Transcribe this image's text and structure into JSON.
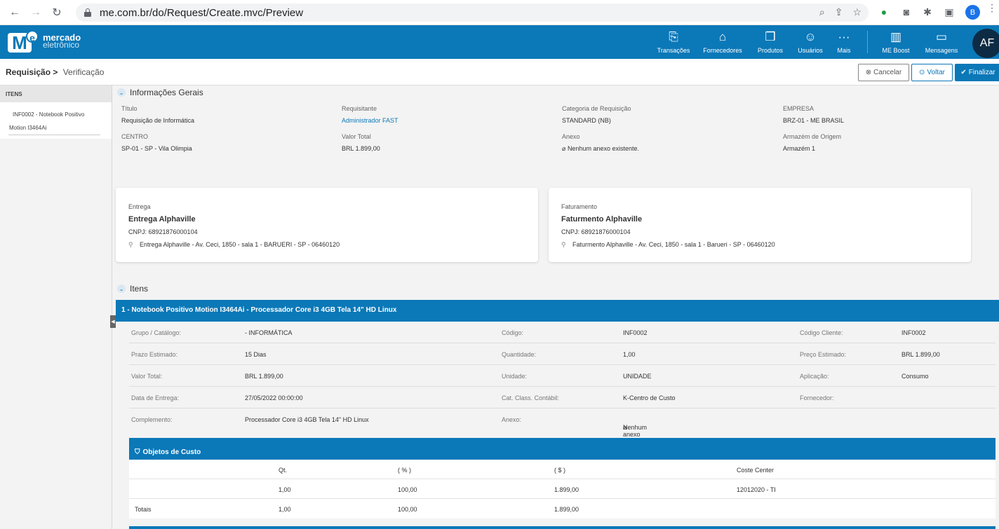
{
  "browser": {
    "url": "me.com.br/do/Request/Create.mvc/Preview",
    "profile_initial": "B"
  },
  "header": {
    "logo_line1": "mercado",
    "logo_line2": "eletrônico",
    "logo_m": "M",
    "logo_e": "e",
    "nav": [
      {
        "label": "Transações",
        "icon": "transactions-icon"
      },
      {
        "label": "Fornecedores",
        "icon": "store-icon"
      },
      {
        "label": "Produtos",
        "icon": "box-icon"
      },
      {
        "label": "Usuários",
        "icon": "users-icon"
      },
      {
        "label": "Mais",
        "icon": "more-icon"
      },
      {
        "label": "ME Boost",
        "icon": "chart-icon"
      },
      {
        "label": "Mensagens",
        "icon": "message-icon"
      }
    ],
    "avatar": "AF"
  },
  "breadcrumb": {
    "part1": "Requisição >",
    "part2": "Verificação"
  },
  "actions": {
    "cancel": "Cancelar",
    "back": "Voltar",
    "finish": "Finalizar"
  },
  "sidebar": {
    "header": "ITENS",
    "item_line1": "INF0002 - Notebook Positivo",
    "item_line2": "Motion I3464Ai"
  },
  "general": {
    "title": "Informações Gerais",
    "fields": [
      {
        "label": "Título",
        "value": "Requisição de Informática"
      },
      {
        "label": "Requisitante",
        "value": "Administrador FAST"
      },
      {
        "label": "Categoria de Requisição",
        "value": "STANDARD (NB)"
      },
      {
        "label": "EMPRESA",
        "value": "BRZ-01 - ME BRASIL"
      },
      {
        "label": "CENTRO",
        "value": "SP-01 - SP - Vila Olimpia"
      },
      {
        "label": "Valor Total",
        "value": "BRL 1.899,00"
      },
      {
        "label": "Anexo",
        "value": "Nenhum anexo existente."
      },
      {
        "label": "Armazém de Origem",
        "value": "Armazém 1"
      }
    ]
  },
  "delivery": {
    "label": "Entrega",
    "name": "Entrega Alphaville",
    "cnpj": "CNPJ: 68921876000104",
    "address": "Entrega Alphaville - Av. Ceci, 1850 - sala 1 - BARUERI - SP - 06460120"
  },
  "billing": {
    "label": "Faturamento",
    "name": "Faturmento Alphaville",
    "cnpj": "CNPJ: 68921876000104",
    "address": "Faturmento Alphaville - Av. Ceci, 1850 - sala 1 - Barueri - SP - 06460120"
  },
  "items": {
    "title": "Itens",
    "item_header": "1 - Notebook Positivo Motion I3464Ai - Processador Core i3 4GB Tela 14\" HD Linux",
    "rows": [
      {
        "k1": "Grupo / Catálogo:",
        "v1": "- INFORMÁTICA",
        "k2": "Código:",
        "v2": "INF0002",
        "k3": "Código Cliente:",
        "v3": "INF0002"
      },
      {
        "k1": "Prazo Estimado:",
        "v1": "15 Dias",
        "k2": "Quantidade:",
        "v2": "1,00",
        "k3": "Preço Estimado:",
        "v3": "BRL 1.899,00"
      },
      {
        "k1": "Valor Total:",
        "v1": "BRL 1.899,00",
        "k2": "Unidade:",
        "v2": "UNIDADE",
        "k3": "Aplicação:",
        "v3": "Consumo"
      },
      {
        "k1": "Data de Entrega:",
        "v1": "27/05/2022 00:00:00",
        "k2": "Cat. Class. Contábil:",
        "v2": "K-Centro de Custo",
        "k3": "Fornecedor:",
        "v3": ""
      },
      {
        "k1": "Complemento:",
        "v1": "Processador Core i3 4GB Tela 14\" HD Linux",
        "k2": "Anexo:",
        "v2": "Nenhum anexo existente.",
        "k3": "",
        "v3": ""
      }
    ]
  },
  "cost": {
    "title": "Objetos de Custo",
    "headers": [
      "Qt.",
      "( % )",
      "( $ )",
      "Coste Center"
    ],
    "row": {
      "label": "",
      "qt": "1,00",
      "pct": "100,00",
      "amt": "1.899,00",
      "center": "12012020 - TI"
    },
    "totals": {
      "label": "Totais",
      "qt": "1,00",
      "pct": "100,00",
      "amt": "1.899,00"
    }
  }
}
